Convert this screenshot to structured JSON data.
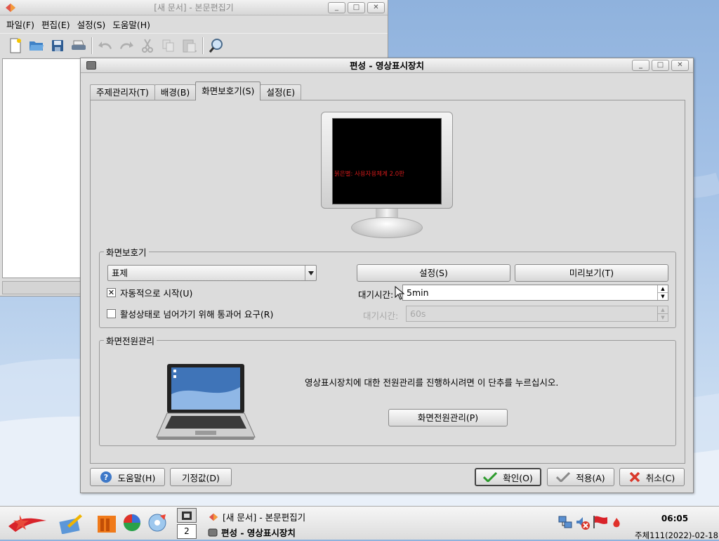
{
  "editor": {
    "title": "[새 문서] - 본문편집기",
    "menus": [
      "파일(F)",
      "편집(E)",
      "설정(S)",
      "도움말(H)"
    ],
    "window_buttons": [
      "_",
      "□",
      "✕"
    ]
  },
  "dialog": {
    "title": "편성 - 영상표시장치",
    "window_buttons": [
      "_",
      "□",
      "✕"
    ],
    "tabs": [
      "주제관리자(T)",
      "배경(B)",
      "화면보호기(S)",
      "설정(E)"
    ],
    "active_tab": "화면보호기(S)",
    "preview_text": "붉은별: 사용자용체계 2.0판",
    "screensaver_group": {
      "legend": "화면보호기",
      "selected": "표제",
      "settings_button": "설정(S)",
      "preview_button": "미리보기(T)",
      "auto_start_label": "자동적으로 시작(U)",
      "auto_start_checked": true,
      "require_pass_label": "활성상태로 넘어가기 위해 통과어 요구(R)",
      "require_pass_checked": false,
      "wait_label": "대기시간:",
      "wait_value": "5min",
      "wait2_label": "대기시간:",
      "wait2_value": "60s"
    },
    "power_group": {
      "legend": "화면전원관리",
      "description": "영상표시장치에 대한 전원관리를 진행하시려면 이 단추를 누르십시오.",
      "button": "화면전원관리(P)"
    },
    "buttons": {
      "help": "도움말(H)",
      "defaults": "기정값(D)",
      "ok": "확인(O)",
      "apply": "적용(A)",
      "cancel": "취소(C)"
    }
  },
  "taskbar": {
    "pager_current": "2",
    "tasks": [
      "[새 문서] - 본문편집기",
      "편성 - 영상표시장치"
    ],
    "clock": "06:05",
    "date": "주체111(2022)-02-18"
  }
}
